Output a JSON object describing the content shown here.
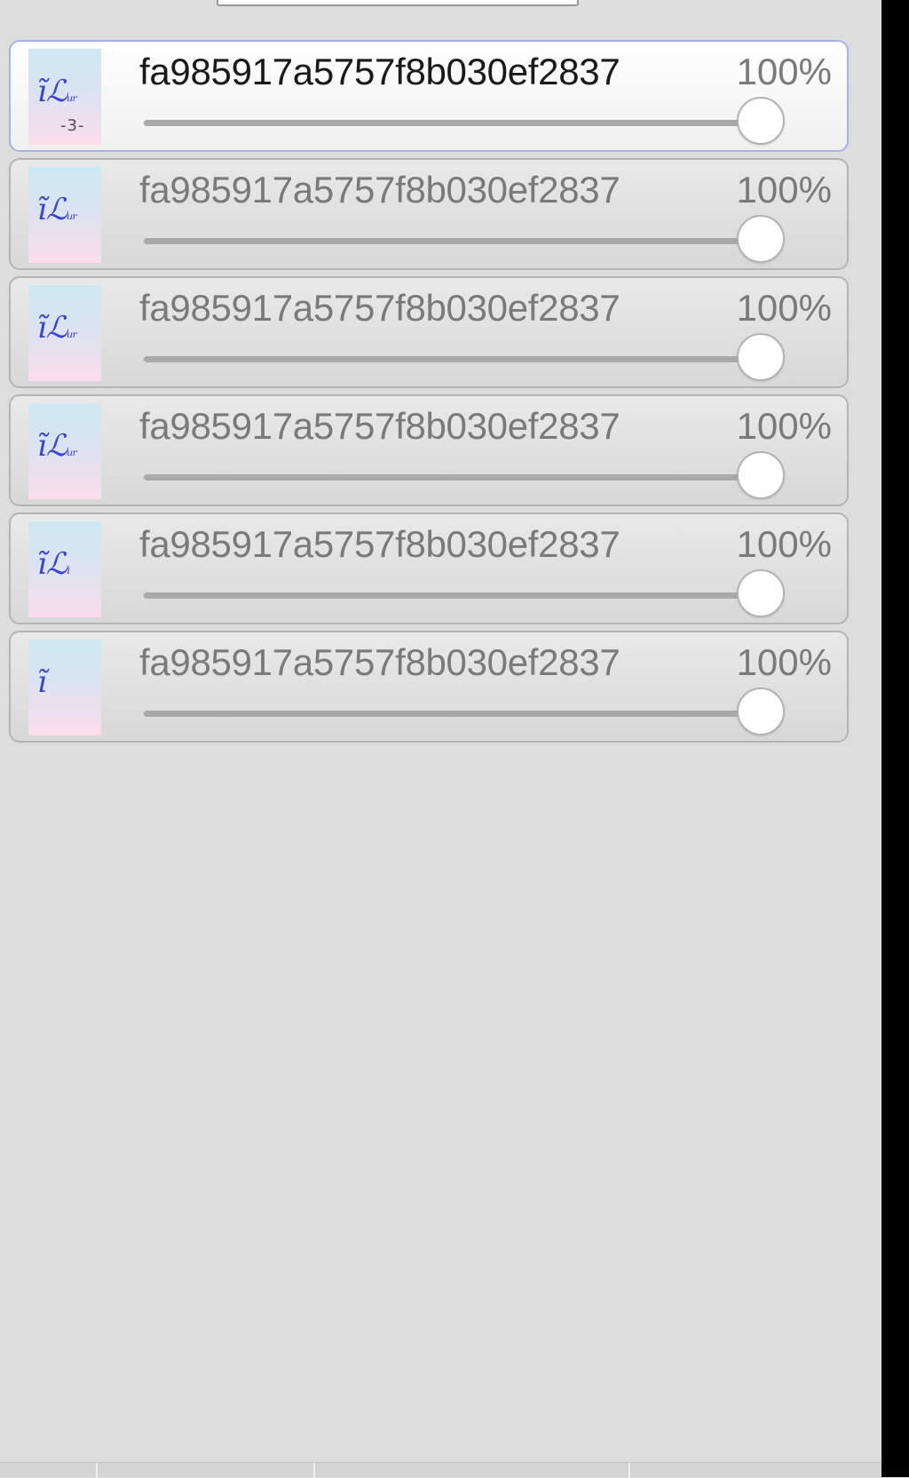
{
  "layers": [
    {
      "name": "fa985917a5757f8b030ef2837",
      "opacity_label": "100%",
      "opacity": 1.0,
      "selected": true,
      "thumb_icon": "layer-thumbnail-icon"
    },
    {
      "name": "fa985917a5757f8b030ef2837",
      "opacity_label": "100%",
      "opacity": 1.0,
      "selected": false,
      "thumb_icon": "layer-thumbnail-icon"
    },
    {
      "name": "fa985917a5757f8b030ef2837",
      "opacity_label": "100%",
      "opacity": 1.0,
      "selected": false,
      "thumb_icon": "layer-thumbnail-icon"
    },
    {
      "name": "fa985917a5757f8b030ef2837",
      "opacity_label": "100%",
      "opacity": 1.0,
      "selected": false,
      "thumb_icon": "layer-thumbnail-icon"
    },
    {
      "name": "fa985917a5757f8b030ef2837",
      "opacity_label": "100%",
      "opacity": 1.0,
      "selected": false,
      "thumb_icon": "layer-thumbnail-icon"
    },
    {
      "name": "fa985917a5757f8b030ef2837",
      "opacity_label": "100%",
      "opacity": 1.0,
      "selected": false,
      "thumb_icon": "layer-thumbnail-icon"
    }
  ],
  "colors": {
    "panel_background": "#dddddd",
    "selected_border": "#a7b2e8",
    "thumbnail_glyph": "#3a43d6"
  }
}
